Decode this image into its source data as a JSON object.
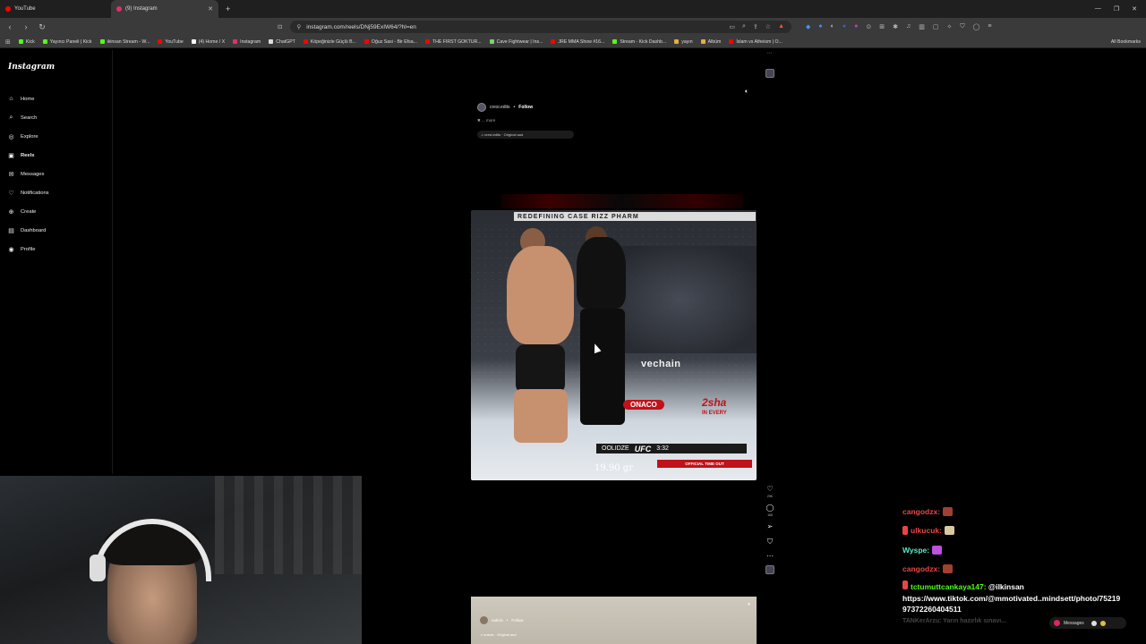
{
  "tabs": [
    {
      "label": "YouTube",
      "color": "#ff0000"
    },
    {
      "label": "(9) Instagram",
      "color": "#e1306c",
      "active": true
    }
  ],
  "address": {
    "url": "instagram.com/reels/DNj59ExIW64/?hl=en"
  },
  "bookmarks": [
    {
      "label": "Kick",
      "color": "#53fc18"
    },
    {
      "label": "Yayıncı Paneli | Kick",
      "color": "#53fc18"
    },
    {
      "label": "ikinsan Stream - W...",
      "color": "#53fc18"
    },
    {
      "label": "YouTube",
      "color": "#ff0000"
    },
    {
      "label": "(4) Home / X",
      "color": "#ffffff"
    },
    {
      "label": "Instagram",
      "color": "#e1306c"
    },
    {
      "label": "ChatGPT",
      "color": "#dddddd"
    },
    {
      "label": "Köpeğinizle Güçlü B...",
      "color": "#ff0000"
    },
    {
      "label": "Oğuz Sasi - Bir Efsa...",
      "color": "#ff0000"
    },
    {
      "label": "THE FIRST GOKTUR...",
      "color": "#ff0000"
    },
    {
      "label": "Cave Fightwear | Ins...",
      "color": "#7bd36b"
    },
    {
      "label": "JRE MMA Show #16...",
      "color": "#ff0000"
    },
    {
      "label": "Stream - Kick Dashb...",
      "color": "#53fc18"
    },
    {
      "label": "yayın",
      "color": "#e0b040"
    },
    {
      "label": "Albüm",
      "color": "#e0b040"
    },
    {
      "label": "İslam vs Atheism | O...",
      "color": "#ff0000"
    }
  ],
  "all_bookmarks": "All Bookmarks",
  "ig": {
    "logo": "Instagram",
    "nav": [
      {
        "label": "Home",
        "icon": "home-icon",
        "glyph": "⌂"
      },
      {
        "label": "Search",
        "icon": "search-icon",
        "glyph": "⌕"
      },
      {
        "label": "Explore",
        "icon": "compass-icon",
        "glyph": "◎"
      },
      {
        "label": "Reels",
        "icon": "reels-icon",
        "glyph": "▣",
        "active": true
      },
      {
        "label": "Messages",
        "icon": "messenger-icon",
        "glyph": "✉"
      },
      {
        "label": "Notifications",
        "icon": "heart-icon",
        "glyph": "♡"
      },
      {
        "label": "Create",
        "icon": "plus-icon",
        "glyph": "⊕"
      },
      {
        "label": "Dashboard",
        "icon": "dashboard-icon",
        "glyph": "▤"
      },
      {
        "label": "Profile",
        "icon": "profile-icon",
        "glyph": "◉"
      }
    ]
  },
  "reel": {
    "username": "cresi.edits",
    "follow": "Follow",
    "more": "... more",
    "audio": "cresi.edits · Original aud",
    "banner_text": "REDEFINING CASE   RIZZ PHARM",
    "vechain": "vechain",
    "monaco": "ONACO",
    "sha": "2sha",
    "inevery": "IN EVERY",
    "score_name": "OOLIDZE",
    "score_org": "UFC",
    "score_time": "3:32",
    "timeout": "OFFICIAL TIME OUT",
    "weight": "19.90 gr"
  },
  "actions": {
    "likes": "29K",
    "comments": "165"
  },
  "next_reel": {
    "username": "nukcis",
    "follow": "Follow",
    "audio": "nukcis · Original aud"
  },
  "chat": [
    {
      "user": "cangodzx:",
      "color": "#e84646",
      "emote": "#a04030",
      "text": ""
    },
    {
      "user": "ulkucuk:",
      "color": "#e84646",
      "emote": "#d9c9a0",
      "text": "",
      "prefix": true
    },
    {
      "user": "Wyspe:",
      "color": "#5ee8c8",
      "emote": "#c050e0",
      "text": ""
    },
    {
      "user": "cangodzx:",
      "color": "#e84646",
      "emote": "#a04030",
      "text": ""
    }
  ],
  "chat_long": {
    "user": "tctumuttcankaya147:",
    "color": "#53fc18",
    "text": " @ilkinsan https://www.tiktok.com/@mmotivated..mindsett/photo/75219 97372260404511"
  },
  "chat_fade": "TANKerArzu: Yarın hazırlık sınavı...",
  "messages_pill": "Messages"
}
